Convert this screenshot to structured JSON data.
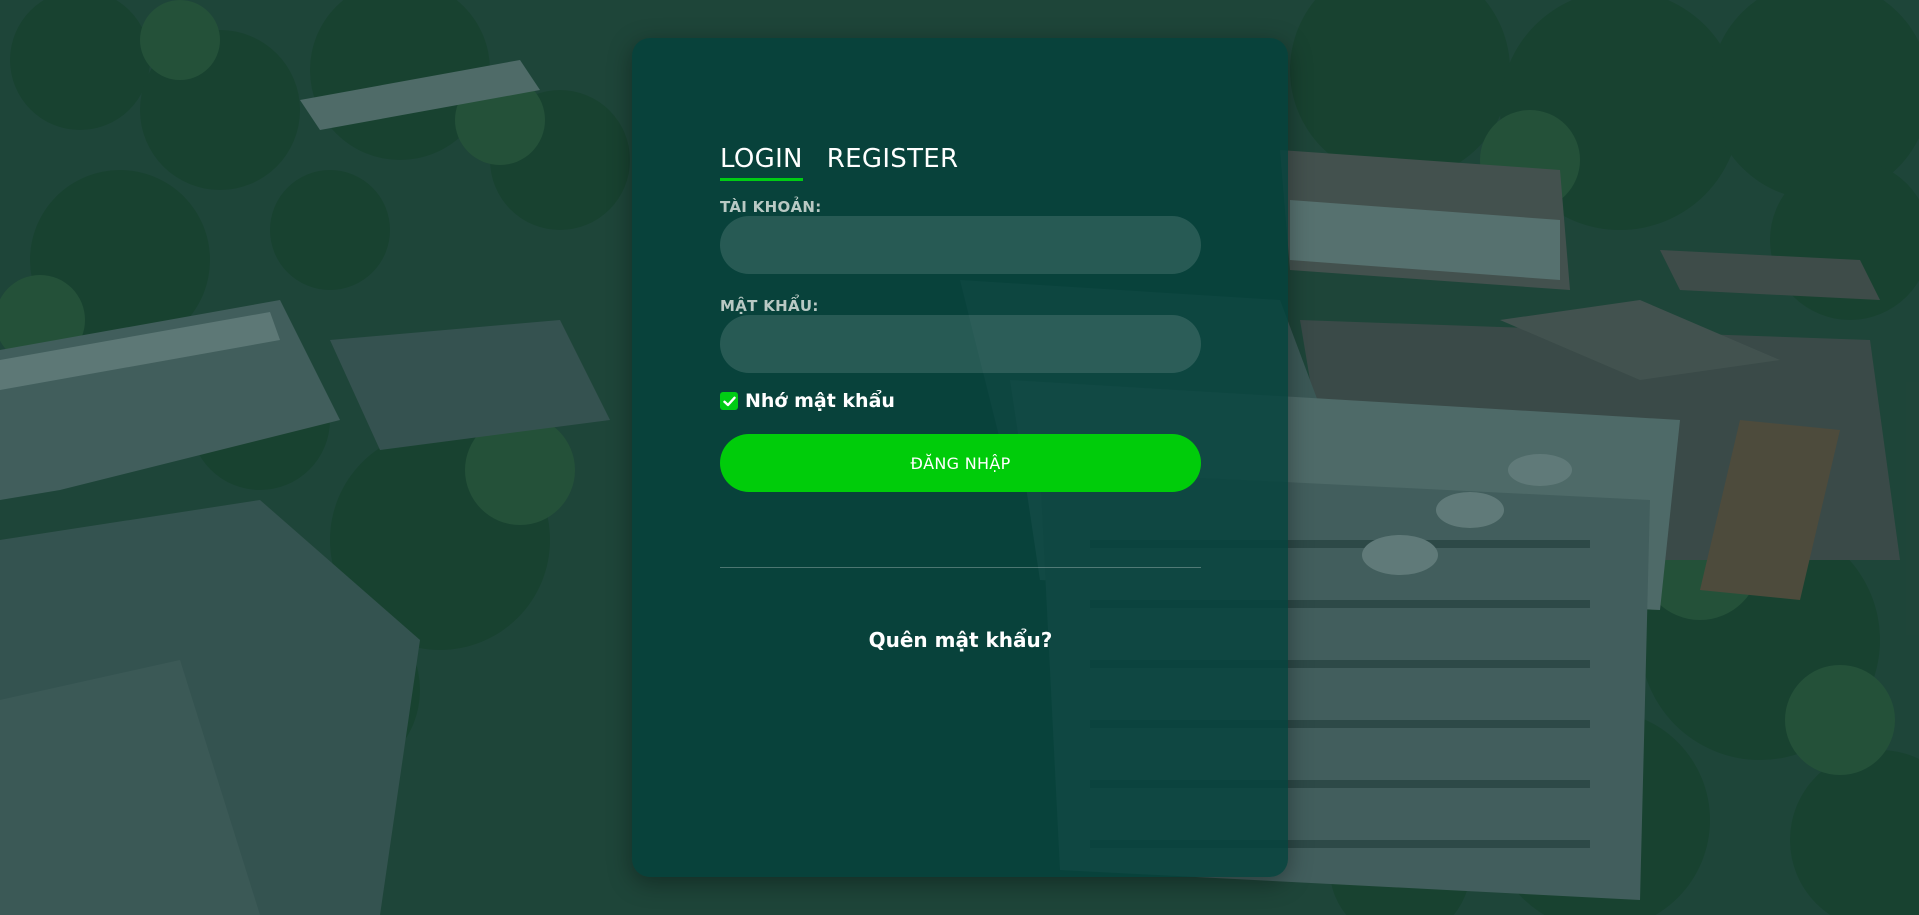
{
  "tabs": {
    "login": "LOGIN",
    "register": "REGISTER"
  },
  "form": {
    "account_label": "TÀI KHOẢN:",
    "account_value": "",
    "password_label": "MẬT KHẨU:",
    "password_value": "",
    "remember_label": "Nhớ mật khẩu",
    "remember_checked": true,
    "submit_label": "ĐĂNG NHẬP"
  },
  "links": {
    "forgot_password": "Quên mật khẩu?"
  },
  "colors": {
    "accent": "#00cc0a",
    "card_background": "#04423c",
    "overlay": "#063030"
  },
  "icons": {
    "checkbox": "check-icon"
  }
}
